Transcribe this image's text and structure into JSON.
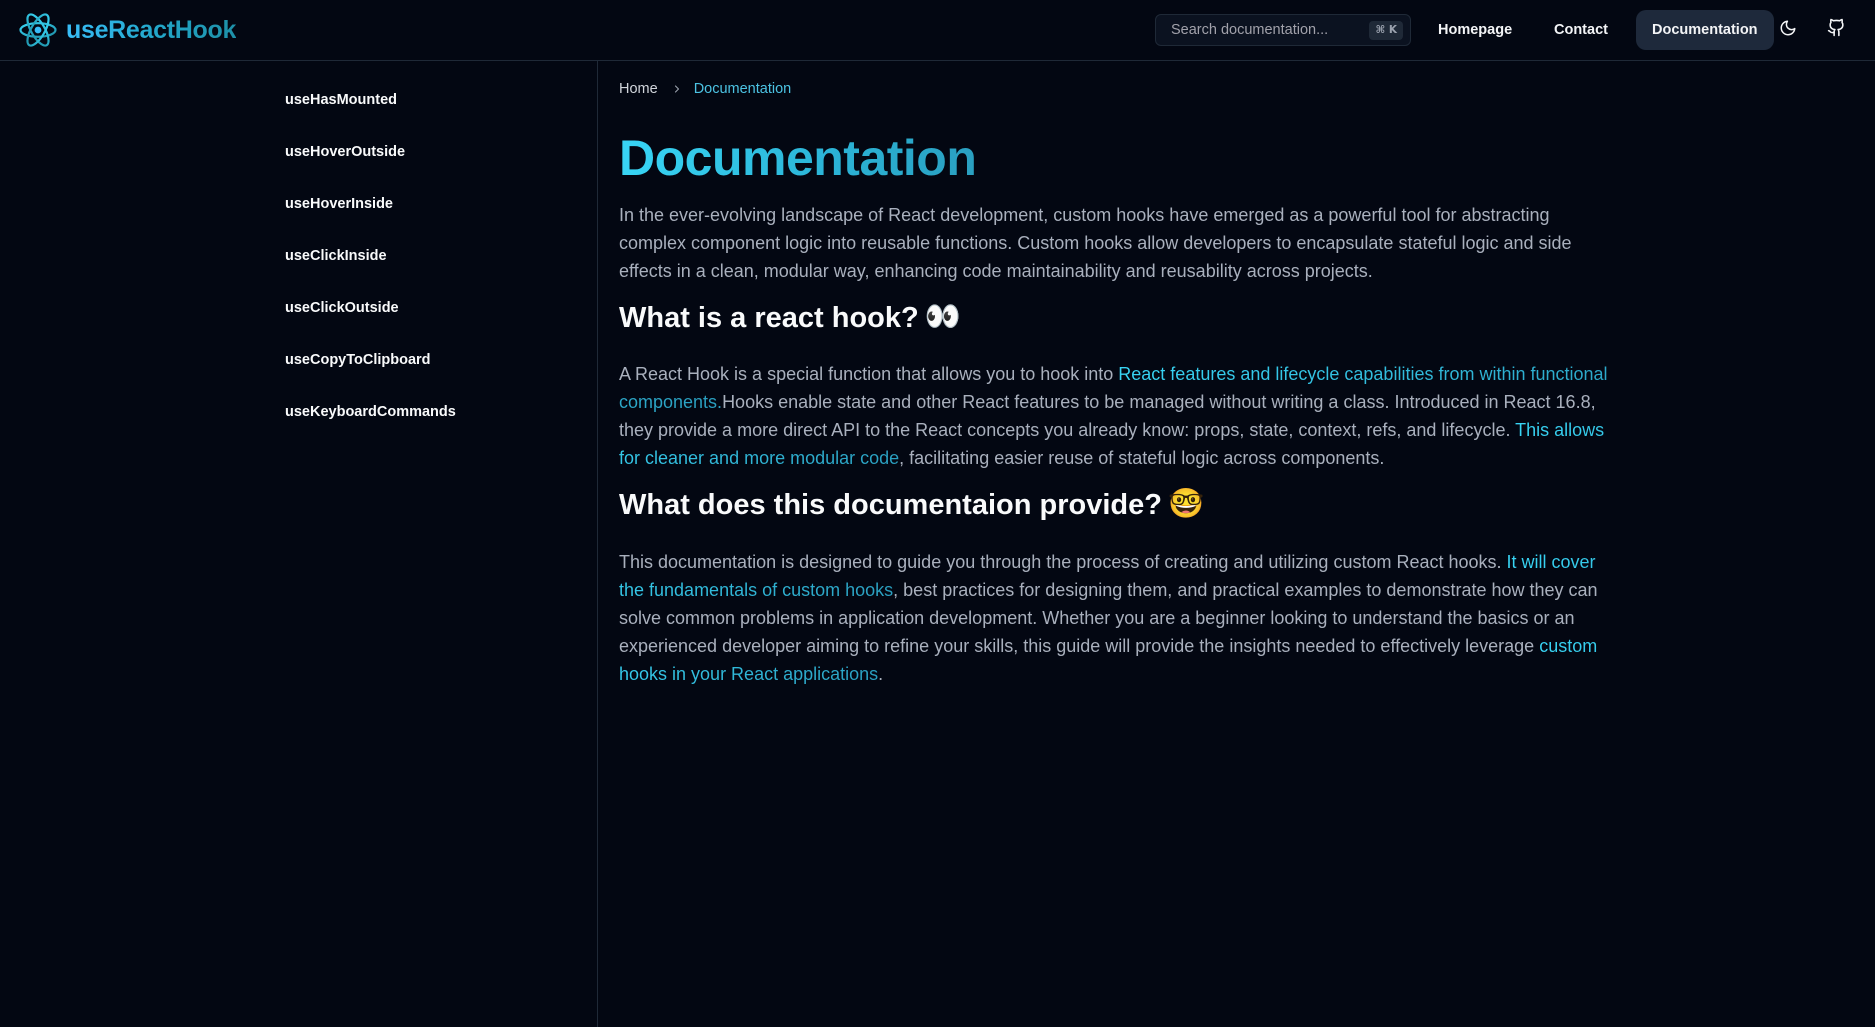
{
  "app": {
    "logo_text": "useReactHook"
  },
  "header": {
    "search_placeholder": "Search documentation...",
    "search_shortcut": "⌘ K",
    "nav": [
      {
        "label": "Homepage"
      },
      {
        "label": "Contact"
      },
      {
        "label": "Documentation",
        "active": true
      }
    ],
    "icons": [
      "react-logo-icon",
      "moon-icon",
      "github-icon"
    ]
  },
  "sidebar": {
    "items": [
      {
        "label": "useHasMounted"
      },
      {
        "label": "useHoverOutside"
      },
      {
        "label": "useHoverInside"
      },
      {
        "label": "useClickInside"
      },
      {
        "label": "useClickOutside"
      },
      {
        "label": "useCopyToClipboard"
      },
      {
        "label": "useKeyboardCommands"
      }
    ]
  },
  "breadcrumb": {
    "home": "Home",
    "current": "Documentation"
  },
  "main": {
    "title": "Documentation",
    "intro": "In the ever-evolving landscape of React development, custom hooks have emerged as a powerful tool for abstracting complex component logic into reusable functions. Custom hooks allow developers to encapsulate stateful logic and side effects in a clean, modular way, enhancing code maintainability and reusability across projects.",
    "section1": {
      "heading": "What is a react hook?",
      "emoji": "👀",
      "text_a": "A React Hook is a special function that allows you to hook into ",
      "link_a": "React features and lifecycle capabilities from within functional components.",
      "text_b": "Hooks enable state and other React features to be managed without writing a class. Introduced in React 16.8, they provide a more direct API to the React concepts you already know: props, state, context, refs, and lifecycle. ",
      "link_b": "This allows for cleaner and more modular code",
      "text_c": ", facilitating easier reuse of stateful logic across components."
    },
    "section2": {
      "heading": "What does this documentaion provide?",
      "emoji": "🤓",
      "text_a": "This documentation is designed to guide you through the process of creating and utilizing custom React hooks. ",
      "link_a": "It will cover the fundamentals of custom hooks",
      "text_b": ", best practices for designing them, and practical examples to demonstrate how they can solve common problems in application development. Whether you are a beginner looking to understand the basics or an experienced developer aiming to refine your skills, this guide will provide the insights needed to effectively leverage ",
      "link_b": "custom hooks in your React applications",
      "text_c": "."
    }
  },
  "colors": {
    "background": "#030712",
    "accent": "#38d5f5",
    "nav_active_bg": "#1e293b",
    "border": "#1f2937"
  }
}
